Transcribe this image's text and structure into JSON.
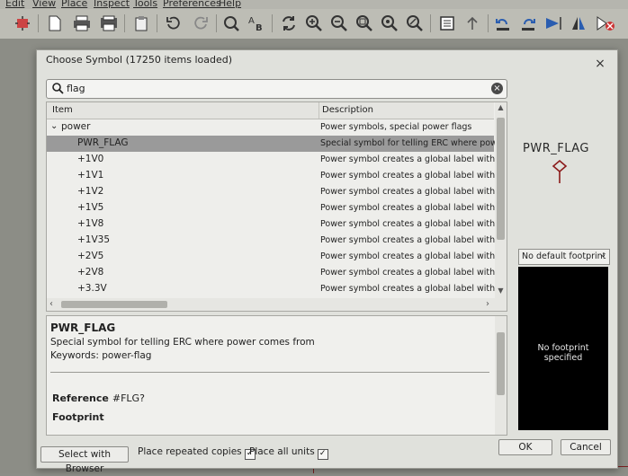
{
  "menubar": {
    "items": [
      "Edit",
      "View",
      "Place",
      "Inspect",
      "Tools",
      "Preferences",
      "Help"
    ]
  },
  "toolbar": {
    "icons": [
      "symbol-editor-icon",
      "new-icon",
      "print-icon",
      "plot-icon",
      "paste-icon",
      "undo-icon",
      "redo-icon",
      "find-icon",
      "find-replace-icon",
      "refresh-icon",
      "zoom-in-icon",
      "zoom-out-icon",
      "zoom-fit-icon",
      "zoom-objects-icon",
      "zoom-selection-icon",
      "hierarchy-icon",
      "navigate-up-icon",
      "rotate-ccw-icon",
      "rotate-cw-icon",
      "mirror-v-icon",
      "mirror-h-icon",
      "erc-icon"
    ]
  },
  "dialog": {
    "title": "Choose Symbol (17250 items loaded)",
    "close_glyph": "×",
    "search": {
      "value": "flag",
      "clear_glyph": "×"
    },
    "tree": {
      "columns": {
        "item": "Item",
        "description": "Description"
      },
      "group": {
        "name": "power",
        "description": "Power symbols, special power flags"
      },
      "rows": [
        {
          "item": "PWR_FLAG",
          "description": "Special symbol for telling ERC where power c",
          "selected": true
        },
        {
          "item": "+1V0",
          "description": "Power symbol creates a global label with nam"
        },
        {
          "item": "+1V1",
          "description": "Power symbol creates a global label with nam"
        },
        {
          "item": "+1V2",
          "description": "Power symbol creates a global label with nam"
        },
        {
          "item": "+1V5",
          "description": "Power symbol creates a global label with nam"
        },
        {
          "item": "+1V8",
          "description": "Power symbol creates a global label with nam"
        },
        {
          "item": "+1V35",
          "description": "Power symbol creates a global label with nam"
        },
        {
          "item": "+2V5",
          "description": "Power symbol creates a global label with nam"
        },
        {
          "item": "+2V8",
          "description": "Power symbol creates a global label with nam"
        },
        {
          "item": "+3.3V",
          "description": "Power symbol creates a global label with nam"
        }
      ]
    },
    "details": {
      "symbol_name": "PWR_FLAG",
      "description": "Special symbol for telling ERC where power comes from",
      "keywords": "Keywords: power-flag",
      "reference_label": "Reference",
      "reference_value": "#FLG?",
      "footprint_label": "Footprint"
    },
    "preview": {
      "symbol_label": "PWR_FLAG",
      "footprint_select": "No default footprint",
      "footprint_empty": "No footprint specified"
    },
    "buttons": {
      "select_with_browser": "Select with Browser",
      "place_repeated": "Place repeated copies",
      "place_all_units": "Place all units",
      "ok": "OK",
      "cancel": "Cancel"
    },
    "checkboxes": {
      "place_repeated": true,
      "place_all_units": true
    },
    "colors": {
      "selected_row": "#9a9a9a",
      "footprint_bg": "#000000",
      "symbol_stroke": "#8b1a1a"
    }
  }
}
